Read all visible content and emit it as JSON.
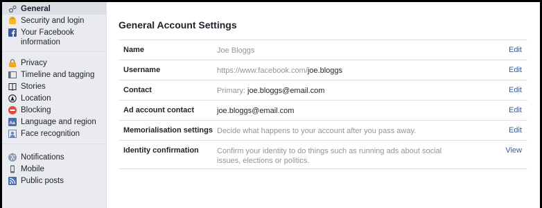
{
  "sidebar": {
    "group1": [
      {
        "label": "General",
        "icon": "gear-icon",
        "active": true
      },
      {
        "label": "Security and login",
        "icon": "shield-icon"
      },
      {
        "label": "Your Facebook information",
        "icon": "facebook-icon"
      }
    ],
    "group2": [
      {
        "label": "Privacy",
        "icon": "lock-icon"
      },
      {
        "label": "Timeline and tagging",
        "icon": "timeline-icon"
      },
      {
        "label": "Stories",
        "icon": "book-icon"
      },
      {
        "label": "Location",
        "icon": "location-icon"
      },
      {
        "label": "Blocking",
        "icon": "block-icon"
      },
      {
        "label": "Language and region",
        "icon": "language-icon"
      },
      {
        "label": "Face recognition",
        "icon": "face-icon"
      }
    ],
    "group3": [
      {
        "label": "Notifications",
        "icon": "globe-icon"
      },
      {
        "label": "Mobile",
        "icon": "mobile-icon"
      },
      {
        "label": "Public posts",
        "icon": "rss-icon"
      }
    ]
  },
  "main": {
    "title": "General Account Settings",
    "rows": [
      {
        "label": "Name",
        "value": "Joe Bloggs",
        "value_bold": "",
        "action": "Edit"
      },
      {
        "label": "Username",
        "value": "https://www.facebook.com/",
        "value_bold": "joe.bloggs",
        "action": "Edit"
      },
      {
        "label": "Contact",
        "value": "Primary: ",
        "value_bold": "joe.bloggs@email.com",
        "action": "Edit"
      },
      {
        "label": "Ad account contact",
        "value": "",
        "value_bold": "joe.bloggs@email.com",
        "action": "Edit"
      },
      {
        "label": "Memorialisation settings",
        "value": "Decide what happens to your account after you pass away.",
        "value_bold": "",
        "action": "Edit"
      },
      {
        "label": "Identity confirmation",
        "value": "Confirm your identity to do things such as running ads about social issues, elections or politics.",
        "value_bold": "",
        "action": "View"
      }
    ]
  }
}
